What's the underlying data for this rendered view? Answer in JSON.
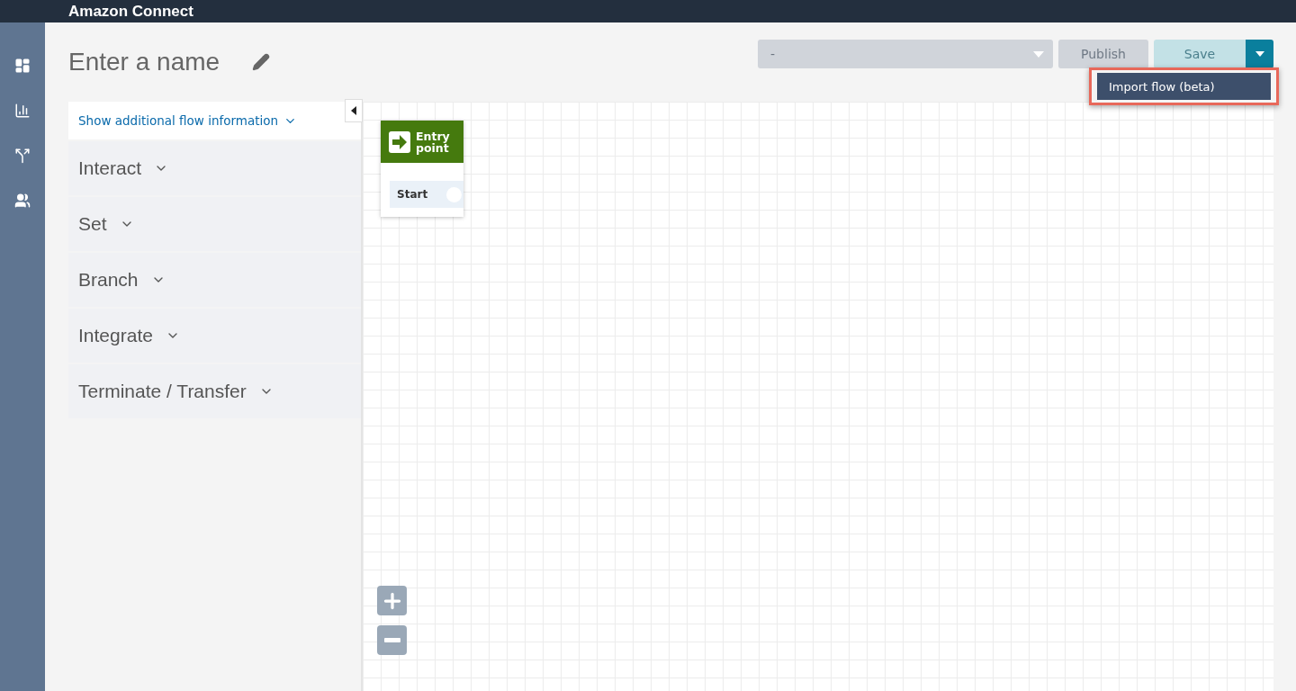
{
  "header": {
    "title": "Amazon Connect"
  },
  "nav": [
    {
      "selected": false
    },
    {
      "selected": false
    },
    {
      "selected": false
    },
    {
      "selected": false
    }
  ],
  "flow_name": {
    "placeholder": "Enter a name"
  },
  "version_select": {
    "value": "-"
  },
  "publish_button": {
    "label": "Publish",
    "disabled": true
  },
  "save_button": {
    "label": "Save",
    "disabled": true
  },
  "save_menu": {
    "open": true,
    "items": [
      {
        "label": "Import flow (beta)",
        "highlighted": true
      }
    ]
  },
  "palette": {
    "info_link": "Show additional flow information",
    "categories": [
      {
        "label": "Interact",
        "expanded": false
      },
      {
        "label": "Set",
        "expanded": false
      },
      {
        "label": "Branch",
        "expanded": false
      },
      {
        "label": "Integrate",
        "expanded": false
      },
      {
        "label": "Terminate / Transfer",
        "expanded": false
      }
    ]
  },
  "canvas": {
    "nodes": [
      {
        "title": "Entry point",
        "branch": "Start"
      }
    ]
  }
}
